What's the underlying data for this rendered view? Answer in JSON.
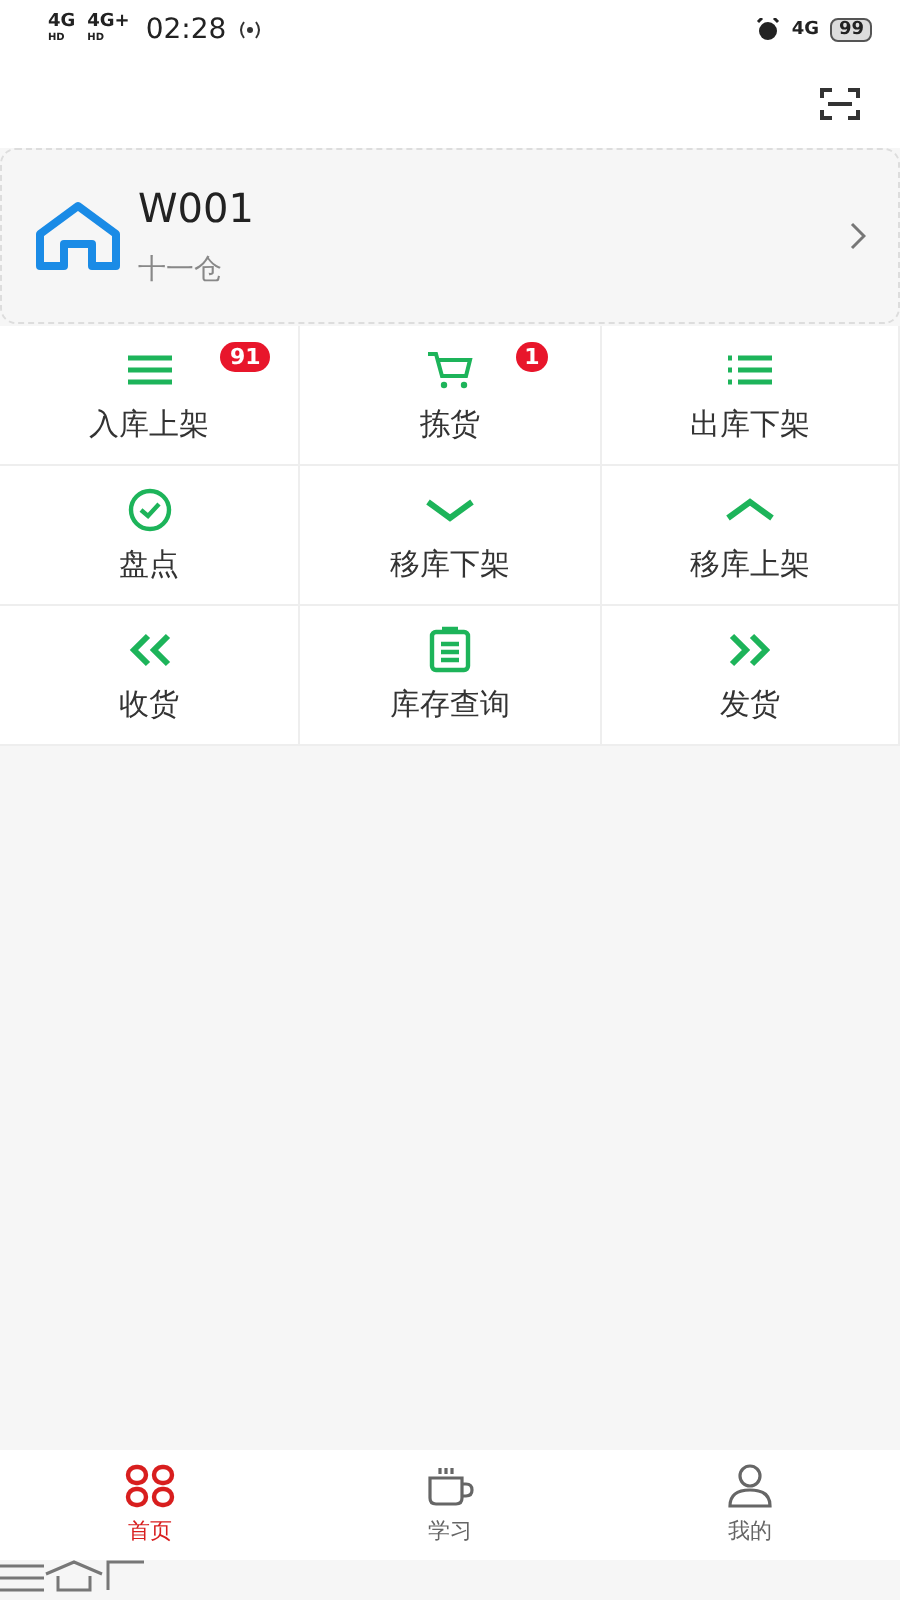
{
  "status_bar": {
    "network_1": "4G",
    "network_1_tag": "HD",
    "network_2": "4G+",
    "network_2_tag": "HD",
    "time": "02:28",
    "network_3": "4G",
    "battery": "99"
  },
  "warehouse": {
    "code": "W001",
    "name": "十一仓"
  },
  "functions": [
    {
      "label": "入库上架",
      "badge": "91"
    },
    {
      "label": "拣货",
      "badge": "1"
    },
    {
      "label": "出库下架"
    },
    {
      "label": "盘点"
    },
    {
      "label": "移库下架"
    },
    {
      "label": "移库上架"
    },
    {
      "label": "收货"
    },
    {
      "label": "库存查询"
    },
    {
      "label": "发货"
    }
  ],
  "tab_bar": [
    {
      "label": "首页",
      "selected": true
    },
    {
      "label": "学习",
      "selected": false
    },
    {
      "label": "我的",
      "selected": false
    }
  ]
}
